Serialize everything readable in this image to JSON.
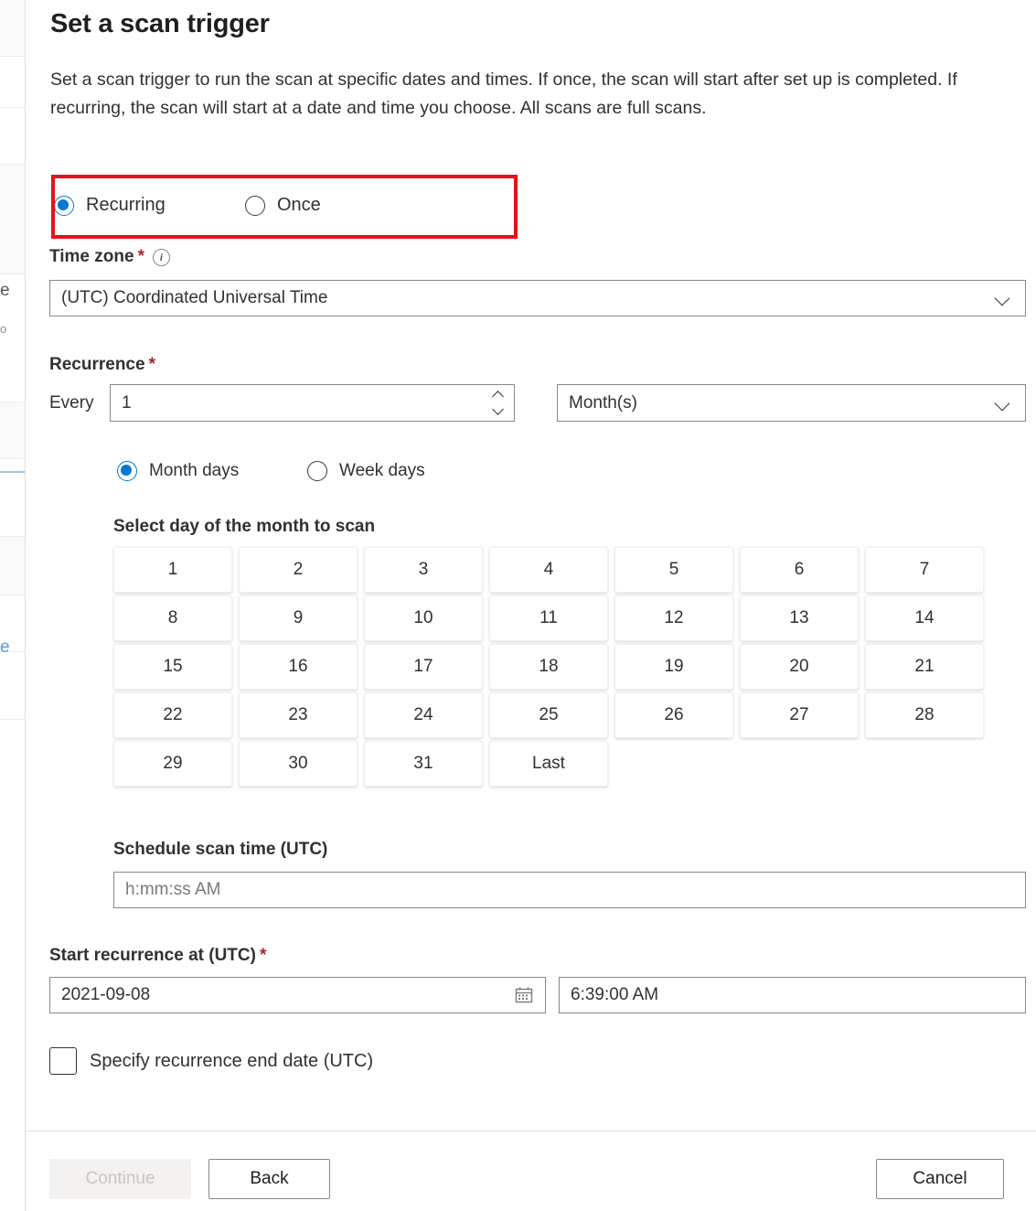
{
  "dialog": {
    "title": "Set a scan trigger",
    "description": "Set a scan trigger to run the scan at specific dates and times. If once, the scan will start after set up is completed. If recurring, the scan will start at a date and time you choose. All scans are full scans."
  },
  "trigger_type": {
    "options": [
      {
        "label": "Recurring",
        "selected": true
      },
      {
        "label": "Once",
        "selected": false
      }
    ]
  },
  "time_zone": {
    "label": "Time zone",
    "required_marker": "*",
    "info_glyph": "i",
    "value": "(UTC) Coordinated Universal Time"
  },
  "recurrence": {
    "label": "Recurrence",
    "required_marker": "*",
    "every_label": "Every",
    "interval_value": "1",
    "unit_value": "Month(s)"
  },
  "day_mode": {
    "options": [
      {
        "label": "Month days",
        "selected": true
      },
      {
        "label": "Week days",
        "selected": false
      }
    ]
  },
  "month_days": {
    "heading": "Select day of the month to scan",
    "cells": [
      "1",
      "2",
      "3",
      "4",
      "5",
      "6",
      "7",
      "8",
      "9",
      "10",
      "11",
      "12",
      "13",
      "14",
      "15",
      "16",
      "17",
      "18",
      "19",
      "20",
      "21",
      "22",
      "23",
      "24",
      "25",
      "26",
      "27",
      "28",
      "29",
      "30",
      "31",
      "Last"
    ]
  },
  "schedule_scan_time": {
    "label": "Schedule scan time (UTC)",
    "value": "",
    "placeholder": "h:mm:ss AM"
  },
  "start_recurrence": {
    "label": "Start recurrence at (UTC)",
    "required_marker": "*",
    "date_value": "2021-09-08",
    "time_value": "6:39:00 AM"
  },
  "end_date_checkbox": {
    "label": "Specify recurrence end date (UTC)",
    "checked": false
  },
  "footer": {
    "continue_label": "Continue",
    "continue_disabled": true,
    "back_label": "Back",
    "cancel_label": "Cancel"
  },
  "highlight": {
    "color": "#e8101a"
  },
  "background_page": {
    "fragments": [
      "e",
      "o",
      "e"
    ]
  }
}
